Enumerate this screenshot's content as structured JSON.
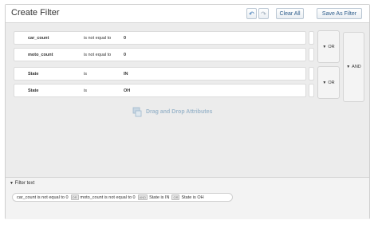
{
  "header": {
    "title": "Create Filter",
    "undo_icon": "undo-icon",
    "redo_icon": "redo-icon",
    "clear_label": "Clear All",
    "save_label": "Save As Filter"
  },
  "conditions": [
    {
      "attribute": "car_count",
      "operator": "is not equal to",
      "value": "0"
    },
    {
      "attribute": "moto_count",
      "operator": "is not equal to",
      "value": "0"
    },
    {
      "attribute": "State",
      "operator": "is",
      "value": "IN"
    },
    {
      "attribute": "State",
      "operator": "is",
      "value": "OH"
    }
  ],
  "groups": {
    "or_label": "OR",
    "and_label": "AND"
  },
  "dropzone": {
    "label": "Drag and Drop Attributes"
  },
  "filter_text": {
    "label": "Filter text",
    "parts": [
      "car_count is not equal to 0",
      "moto_count is not equal to 0",
      "State is IN",
      "State is OH"
    ],
    "or_connector": "OR",
    "and_connector": "AND"
  },
  "colors": {
    "accent": "#2c5c8a",
    "panel_bg": "#ececec",
    "dropzone_text": "#9fb8cc"
  }
}
